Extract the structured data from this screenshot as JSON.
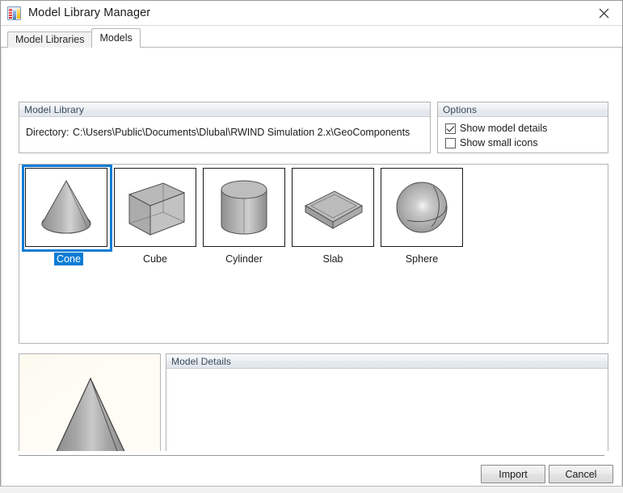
{
  "window": {
    "title": "Model Library Manager",
    "icon": "library-icon",
    "close_icon": "close-icon"
  },
  "tabs": [
    {
      "label": "Model Libraries",
      "active": false
    },
    {
      "label": "Models",
      "active": true
    }
  ],
  "model_library": {
    "group_title": "Model Library",
    "directory_label": "Directory:",
    "directory_value": "C:\\Users\\Public\\Documents\\Dlubal\\RWIND Simulation 2.x\\GeoComponents"
  },
  "options": {
    "group_title": "Options",
    "items": [
      {
        "label": "Show model details",
        "checked": true
      },
      {
        "label": "Show small icons",
        "checked": false
      }
    ]
  },
  "models": {
    "selected": "Cone",
    "items": [
      {
        "label": "Cone",
        "icon": "cone-icon",
        "selected": true
      },
      {
        "label": "Cube",
        "icon": "cube-icon",
        "selected": false
      },
      {
        "label": "Cylinder",
        "icon": "cylinder-icon",
        "selected": false
      },
      {
        "label": "Slab",
        "icon": "slab-icon",
        "selected": false
      },
      {
        "label": "Sphere",
        "icon": "sphere-icon",
        "selected": false
      }
    ]
  },
  "preview": {
    "icon": "cone-preview-icon",
    "shape": "Cone"
  },
  "model_details": {
    "group_title": "Model Details",
    "content": ""
  },
  "footer": {
    "import_label": "Import",
    "cancel_label": "Cancel"
  },
  "colors": {
    "selection_blue": "#0b7cd4",
    "group_header_text": "#3a4a5c",
    "border": "#b4b4b4",
    "preview_bg": "#fdfaf0"
  }
}
